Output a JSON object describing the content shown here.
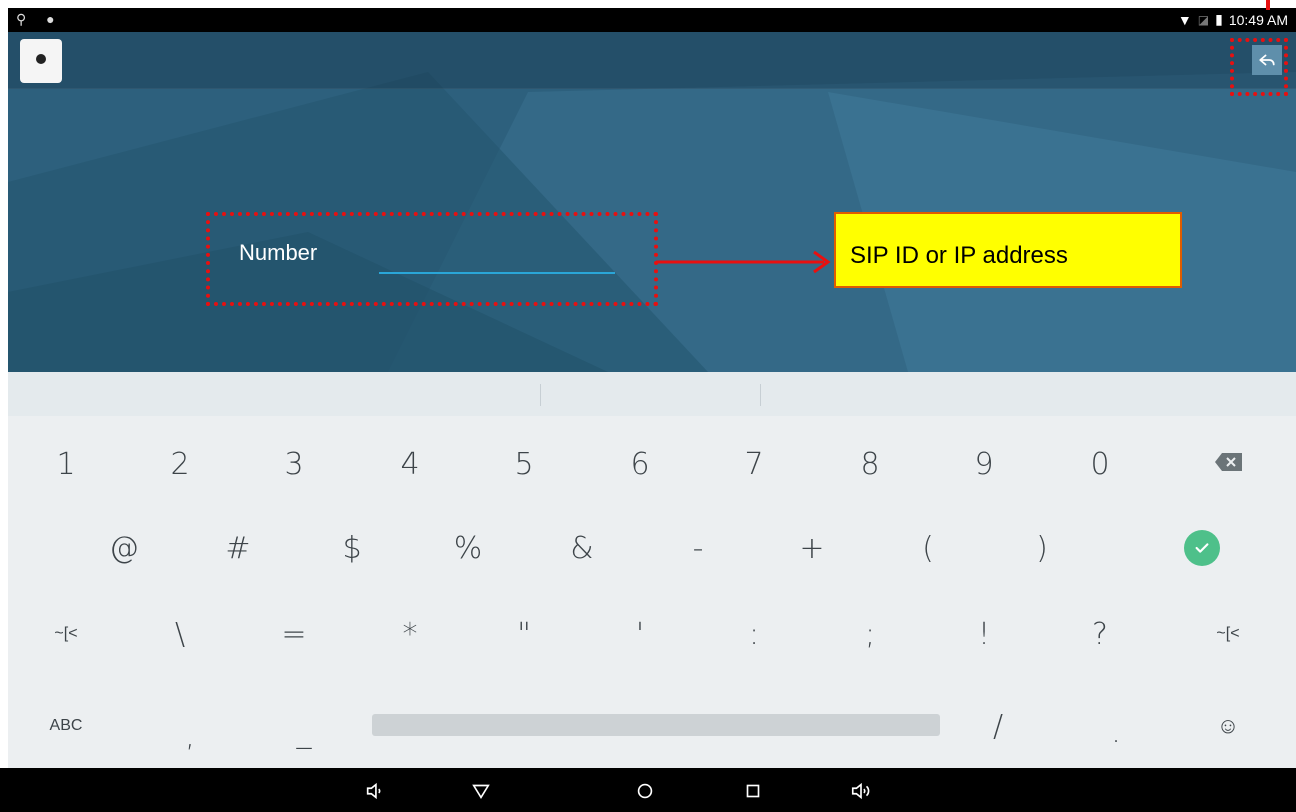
{
  "status_bar": {
    "time": "10:49 AM"
  },
  "header": {
    "back_icon": "reply-back-icon"
  },
  "form": {
    "number_label": "Number",
    "number_value": ""
  },
  "annotations": {
    "callout_text": "SIP ID or IP address"
  },
  "keyboard": {
    "row1": [
      "1",
      "2",
      "3",
      "4",
      "5",
      "6",
      "7",
      "8",
      "9",
      "0"
    ],
    "row2": [
      "@",
      "#",
      "$",
      "%",
      "&",
      "-",
      "+",
      "(",
      ")"
    ],
    "row3": [
      "~[<",
      "\\",
      "=",
      "*",
      "\"",
      "'",
      ":",
      ";",
      "!",
      "?",
      "~[<"
    ],
    "row4": [
      "ABC",
      ",",
      "_",
      "/",
      ".",
      "☺"
    ]
  },
  "colors": {
    "accent": "#2aa6d8",
    "done": "#4ec08a",
    "callout": "#ffff00",
    "annotation": "#e81010"
  }
}
